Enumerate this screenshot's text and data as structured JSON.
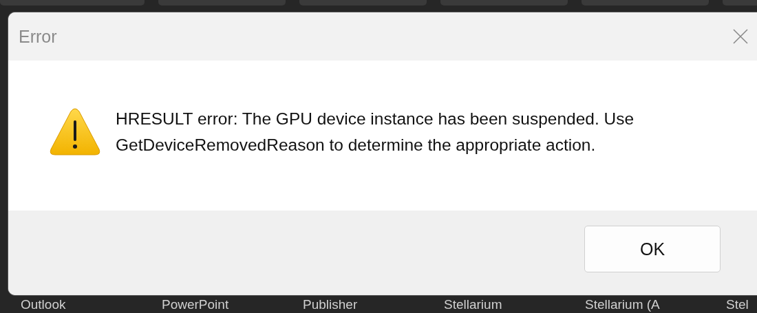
{
  "desktop": {
    "tiles": [
      {
        "label": "Outlook"
      },
      {
        "label": "PowerPoint"
      },
      {
        "label": "Publisher"
      },
      {
        "label": "Stellarium"
      },
      {
        "label": "Stellarium (A"
      },
      {
        "label": "Stel"
      }
    ]
  },
  "dialog": {
    "title": "Error",
    "kind": "warning",
    "message": "HRESULT error: The GPU device instance has been suspended. Use GetDeviceRemovedReason to determine the appropriate action.",
    "buttons": [
      "OK"
    ]
  }
}
